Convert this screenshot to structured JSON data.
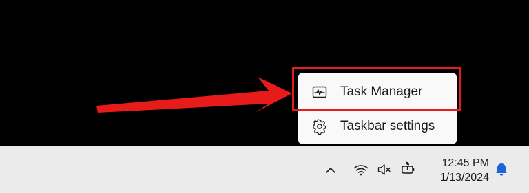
{
  "context_menu": {
    "items": [
      {
        "label": "Task Manager",
        "icon": "task-manager-icon"
      },
      {
        "label": "Taskbar settings",
        "icon": "gear-icon"
      }
    ]
  },
  "annotation": {
    "color": "#e81b1b"
  },
  "taskbar": {
    "tray_icons": [
      "chevron-up-icon",
      "wifi-icon",
      "volume-muted-icon",
      "battery-charging-icon"
    ],
    "clock": {
      "time": "12:45 PM",
      "date": "1/13/2024"
    },
    "notification_icon": "bell-icon",
    "accent_color": "#1a66d6"
  }
}
